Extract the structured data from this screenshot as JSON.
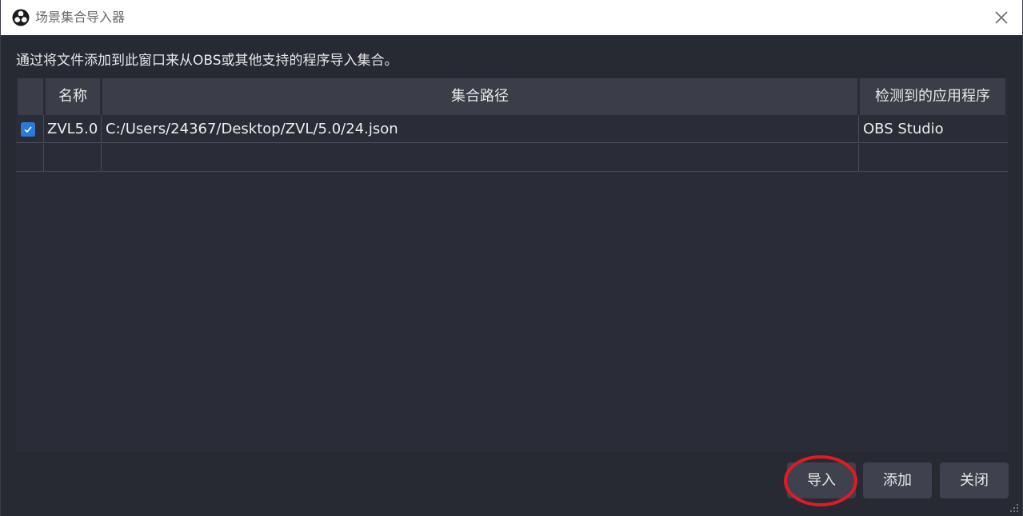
{
  "window": {
    "title": "场景集合导入器",
    "icon": "obs-logo-icon",
    "close_icon": "close-icon"
  },
  "description": "通过将文件添加到此窗口来从OBS或其他支持的程序导入集合。",
  "table": {
    "headers": {
      "name": "名称",
      "path": "集合路径",
      "program": "检测到的应用程序"
    },
    "rows": [
      {
        "checked": true,
        "name": "ZVL5.0",
        "path": "C:/Users/24367/Desktop/ZVL/5.0/24.json",
        "program": "OBS Studio"
      },
      {
        "checked": false,
        "name": "",
        "path": "",
        "program": ""
      }
    ]
  },
  "buttons": {
    "import": "导入",
    "add": "添加",
    "close": "关闭"
  },
  "colors": {
    "accent": "#2b7bd6",
    "annotation": "#e21b22"
  }
}
